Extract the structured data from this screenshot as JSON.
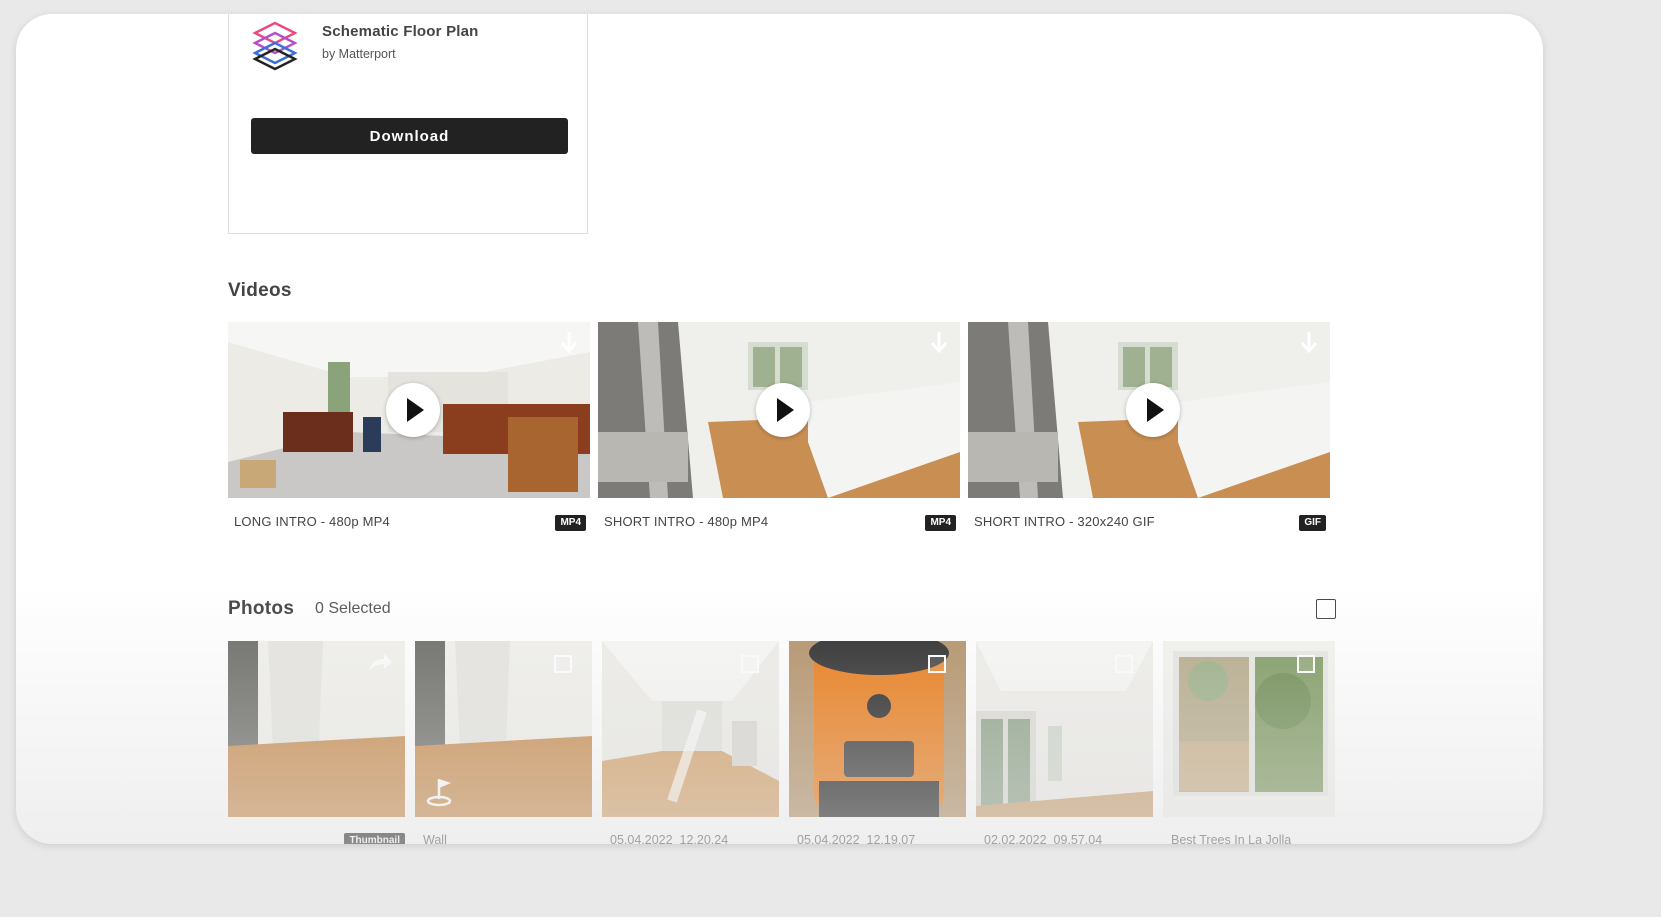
{
  "app": {
    "title": "Schematic Floor Plan",
    "by": "by Matterport",
    "download_label": "Download"
  },
  "videos": {
    "title": "Videos",
    "items": [
      {
        "label": "LONG INTRO - 480p MP4",
        "format": "MP4"
      },
      {
        "label": "SHORT INTRO - 480p MP4",
        "format": "MP4"
      },
      {
        "label": "SHORT INTRO - 320x240 GIF",
        "format": "GIF"
      }
    ]
  },
  "photos": {
    "title": "Photos",
    "selected": "0 Selected",
    "items": [
      {
        "label": "",
        "badge": "Thumbnail"
      },
      {
        "label": "Wall"
      },
      {
        "label": "05.04.2022_12.20.24"
      },
      {
        "label": "05.04.2022_12.19.07"
      },
      {
        "label": "02.02.2022_09.57.04"
      },
      {
        "label": "Best Trees In La Jolla"
      }
    ]
  },
  "colors": {
    "accent": "#222222",
    "brand_logo_pink": "#e84a7f",
    "brand_logo_blue": "#3a6fd8"
  }
}
